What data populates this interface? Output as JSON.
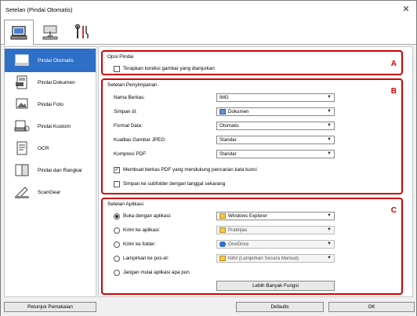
{
  "window": {
    "title": "Setelan (Pindai Otomatis)"
  },
  "tabs": [
    {
      "name": "scan-tab",
      "icon": "scan-computer-icon"
    },
    {
      "name": "save-tab",
      "icon": "scan-to-pc-icon"
    },
    {
      "name": "general-tab",
      "icon": "tools-icon"
    }
  ],
  "sidebar": {
    "items": [
      {
        "label": "Pindai Otomatis",
        "icon": "auto-scan-icon"
      },
      {
        "label": "Pindai Dokumen",
        "icon": "document-scan-icon"
      },
      {
        "label": "Pindai Foto",
        "icon": "photo-scan-icon"
      },
      {
        "label": "Pindai Kustom",
        "icon": "custom-scan-icon"
      },
      {
        "label": "OCR",
        "icon": "ocr-icon"
      },
      {
        "label": "Pindai dan Rangkai",
        "icon": "stitch-icon"
      },
      {
        "label": "ScanGear",
        "icon": "scangear-icon"
      }
    ]
  },
  "scan_options": {
    "title": "Opsi Pindai",
    "marker": "A",
    "apply_correction": {
      "label": "Terapkan koreksi gambar yang dianjurkan",
      "checked": false
    }
  },
  "save_settings": {
    "title": "Setelan Penyimpanan",
    "marker": "B",
    "file_name": {
      "label": "Nama Berkas:",
      "value": "IMG"
    },
    "save_in": {
      "label": "Simpan di:",
      "value": "Dokumen"
    },
    "data_format": {
      "label": "Format Data:",
      "value": "Otomatis"
    },
    "jpeg_quality": {
      "label": "Kualitas Gambar JPEG:",
      "value": "Standar"
    },
    "pdf_compression": {
      "label": "Kompresi PDF:",
      "value": "Standar"
    },
    "searchable_pdf": {
      "label": "Membuat berkas PDF yang mendukung pencarian kata kunci",
      "checked": true
    },
    "subfolder_date": {
      "label": "Simpan ke subfolder dengan tanggal sekarang",
      "checked": false
    }
  },
  "app_settings": {
    "title": "Setelan Aplikasi",
    "marker": "C",
    "open_with": {
      "label": "Buka dengan aplikasi:",
      "value": "Windows Explorer",
      "selected": true
    },
    "send_to_app": {
      "label": "Kirim ke aplikasi:",
      "value": "Pratinjau",
      "selected": false
    },
    "send_to_folder": {
      "label": "Kirim ke folder:",
      "value": "OneDrive",
      "selected": false
    },
    "attach_email": {
      "label": "Lampirkan ke pos-el:",
      "value": "Nihil (Lampirkan Secara Manual)",
      "selected": false
    },
    "no_app": {
      "label": "Jangan mulai aplikasi apa pun",
      "selected": false
    },
    "more_functions": "Lebih Banyak Fungsi"
  },
  "footer": {
    "instructions": "Petunjuk Pemakaian",
    "defaults": "Defaults",
    "ok": "OK"
  },
  "colors": {
    "accent": "#2e6fc7",
    "marker": "#d40000"
  }
}
